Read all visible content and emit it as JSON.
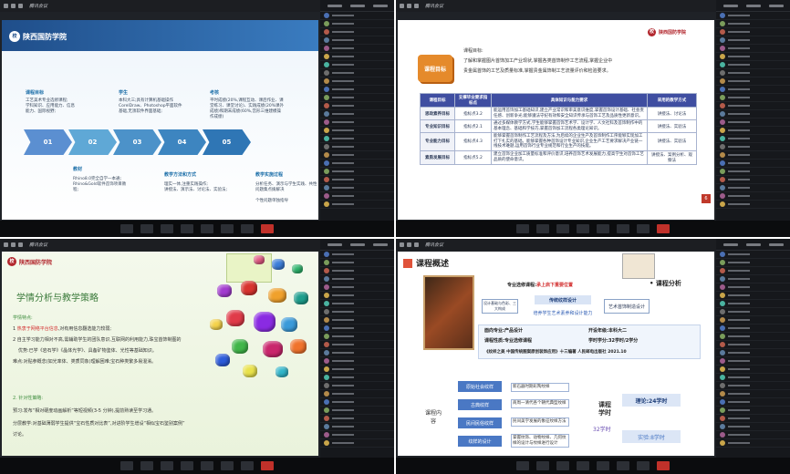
{
  "quad1": {
    "title": "腾讯会议",
    "school": "陕西国防学院",
    "labels": [
      "课程目标",
      "学生",
      "考核",
      "教材",
      "教学方法和方式",
      "教学实施过程"
    ],
    "steps": [
      "01",
      "02",
      "03",
      "04",
      "05"
    ],
    "texts": [
      "工艺美术专业选修课程;",
      "学科知识、应用能力、信息",
      "能力、国际视野;",
      "本科大三;具有计算机基础操作",
      "CorelDraw、Photoshop平面软件",
      "基础,无须软件界面基础;",
      "平时成绩(20%,课程互动、课后作业、课",
      "堂练习、课堂讨论)、实践成绩(20%课外",
      "成绩)和期末成绩(60%,宫形三维建模操",
      "作成绩)",
      "Rhino8.0完全自学一本通;",
      "Rhino&Gold软件首饰项目教",
      "程;",
      "理实一体,注重实践操作;",
      "讲授法、演示法、讨论法、实验法;",
      "分析任务、演示与学生实践、共性问题集点拨解决",
      "个性问题单独指导"
    ]
  },
  "quad2": {
    "title": "腾讯会议",
    "badge": "课程目标",
    "intro1": "课程目标:",
    "intro2": "了解和掌握图片首饰加工产业现状,掌握各类首饰制作工艺流程,掌握企业中",
    "intro3": "贵金属首饰的工艺及质量标准,掌握贵金属饰制工艺流量评价和检验要求。",
    "headers": [
      "课程目标",
      "支撑毕业要求指标点",
      "具体知识与能力要求",
      "采用的教学方式"
    ],
    "rows": [
      {
        "goal": "思政素养目标",
        "idx": "指标点3.2",
        "req": "能运用首饰加工基础知识,建立产业常识和审美意识维度,掌握首饰设计基础、社会责任感、创新争光;能够遵法守纪有效和安全知识传承与首饰工艺及品质性更新意识。",
        "way": "讲授法、讨论法"
      },
      {
        "goal": "专业知识目标",
        "idx": "指标点2.1",
        "req": "通过多媒体教学方式,学生能够掌握首饰艺术学、设计学、人文社科及首饰制作中的基本理念、基础和学技巧,掌握首饰加工流程各类理论知识。",
        "way": "讲授法、实验法"
      },
      {
        "goal": "专业能力目标",
        "idx": "指标点4.3",
        "req": "能够掌握首饰制作工艺流程及方法,为后续的企业生产及首饰制作工序能够实现加工打下扎实的基础。能够掌握各种首饰设计专业知识,企业生产工艺要求解决产业链一线技术难题,运用首饰行业专业规范和行业生产的技能。",
        "way": "讲授法、实验法"
      },
      {
        "goal": "素质发展目标",
        "idx": "指标点5.2",
        "req": "建立首饰企业加工质量标准和评价意识,培养首饰艺术发展能力,提高学生对首饰工艺品质的使命意识。",
        "way": "讲授法、案例分析、观察法"
      }
    ],
    "page": "6"
  },
  "quad3": {
    "title": "腾讯会议",
    "school": "陕西国防学院",
    "heading": "学情分析与教学策略",
    "sub1": "学情特点:",
    "p1_prefix": "1",
    "p1_red": "热衷于网络平台信息",
    "p1_rest": ",对有用信息翻选能力较弱;",
    "p2": "2 自主学习能力相对不高,需辅助学生的团队意识,互联网的利用能力,珠宝首饰制图的",
    "p3": "优势:已学《岩石学》《晶体光学》、具备矿物鉴体、光性等基础知识。",
    "p4": "难点:对贴参概念(如光率体、类质同象)理解困难;宝石种类繁多易混淆。",
    "sub2": "2. 针对性策略:",
    "p5": "预习:发布“相对硬度动画解析”等短视频(3-5 分钟),提前熟读至学习通。",
    "p6": "分层教学:对基础薄弱学生提供“宝石性质对比表”,对进阶学生增设“相似宝石鉴别案例”",
    "p7": "讨论。"
  },
  "quad4": {
    "title": "腾讯会议",
    "heading": "课程概述",
    "tag": "课程分析",
    "main": "专业选修课程:",
    "main_red": "承上启下重要位置",
    "center": "传统纹样设计",
    "left1": "设计基础与色彩、三大构成",
    "right1": "艺术首饰制造设计",
    "bottom": "培养学生艺术素养和设计能力",
    "i1": "面向专业:产品设计",
    "i1b": "开设年级:本科大二",
    "i2": "课程性质:专业选修课程",
    "i2b": "学时学分:32学时/2学分",
    "i3": "《纹样之美 中国传统图案原创装饰应用》十三编著 人民邮电出版社 2021.10",
    "content": "课程内容",
    "items": [
      "原始社会纹样",
      "古典纹样",
      "民间民俗纹样",
      "纹样的设计"
    ],
    "descs": [
      "新石器时期彩陶纹样",
      "商周一清代各个朝代典型纹样",
      "民间美学发展的象征纹样方法",
      "掌握纹饰、动物纹样、几何纹样的设计与纹样进行设计"
    ],
    "hours": "课程学时",
    "hours_total": "32学时",
    "h1": "理论:24学时",
    "h2": "实验:8学时"
  }
}
